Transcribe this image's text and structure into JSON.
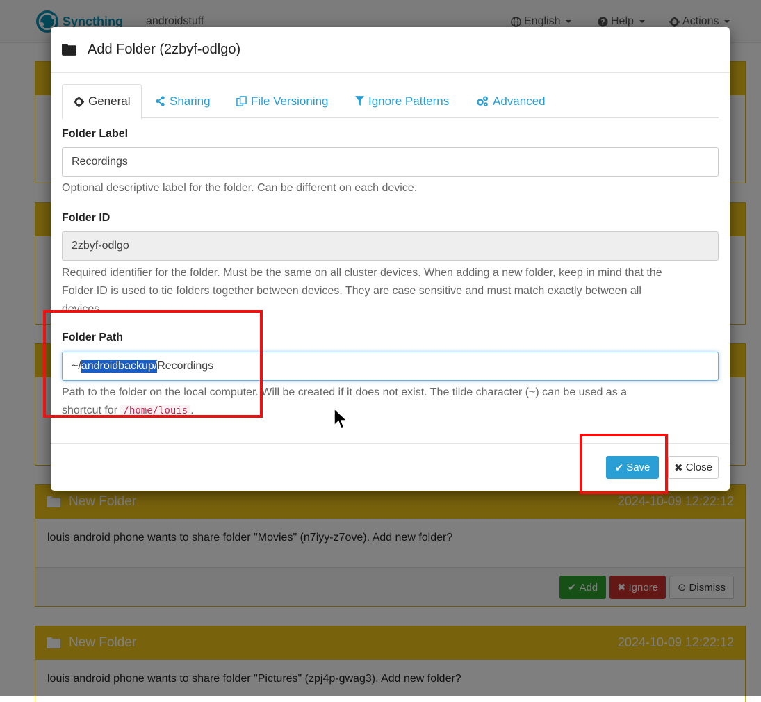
{
  "navbar": {
    "brand": "Syncthing",
    "device_name": "androidstuff",
    "language": "English",
    "help": "Help",
    "actions": "Actions"
  },
  "notifications": [
    {
      "title": "New Folder",
      "time": "2024-10-09 12:22:12",
      "message": "louis android phone wants to share folder \"Movies\" (n7iyy-z7ove). Add new folder?",
      "buttons": {
        "add": "Add",
        "ignore": "Ignore",
        "dismiss": "Dismiss"
      }
    },
    {
      "title": "New Folder",
      "time": "2024-10-09 12:22:12",
      "message": "louis android phone wants to share folder \"Pictures\" (zpj4p-gwag3). Add new folder?"
    }
  ],
  "modal": {
    "title": "Add Folder (2zbyf-odlgo)",
    "tabs": [
      {
        "label": "General",
        "icon": "gear-icon",
        "active": true
      },
      {
        "label": "Sharing",
        "icon": "share-icon"
      },
      {
        "label": "File Versioning",
        "icon": "copy-icon"
      },
      {
        "label": "Ignore Patterns",
        "icon": "filter-icon"
      },
      {
        "label": "Advanced",
        "icon": "cogs-icon"
      }
    ],
    "folder_label": {
      "label": "Folder Label",
      "value": "Recordings",
      "help": "Optional descriptive label for the folder. Can be different on each device."
    },
    "folder_id": {
      "label": "Folder ID",
      "value": "2zbyf-odlgo",
      "help_line1": "Required identifier for the folder. Must be the same on all cluster devices. When adding a new folder, keep in mind that the",
      "help_line2": "Folder ID is used to tie folders together between devices. They are case sensitive and must match exactly between all",
      "help_line3": "devices."
    },
    "folder_path": {
      "label": "Folder Path",
      "value_prefix": "~/",
      "value_selected": "androidbackup/",
      "value_suffix": "Recordings",
      "help_line1": "Path to the folder on the local computer. Will be created if it does not exist. The tilde character (~) can be used as a",
      "help_line2_prefix": "shortcut for",
      "help_code": "/home/louis",
      "help_line2_suffix": "."
    },
    "buttons": {
      "save": "Save",
      "close": "Close"
    }
  },
  "colors": {
    "accent": "#2a9fd6",
    "warning_panel": "#f0c419",
    "success": "#2ca02c",
    "danger": "#c9302c",
    "highlight": "#ee1111"
  }
}
